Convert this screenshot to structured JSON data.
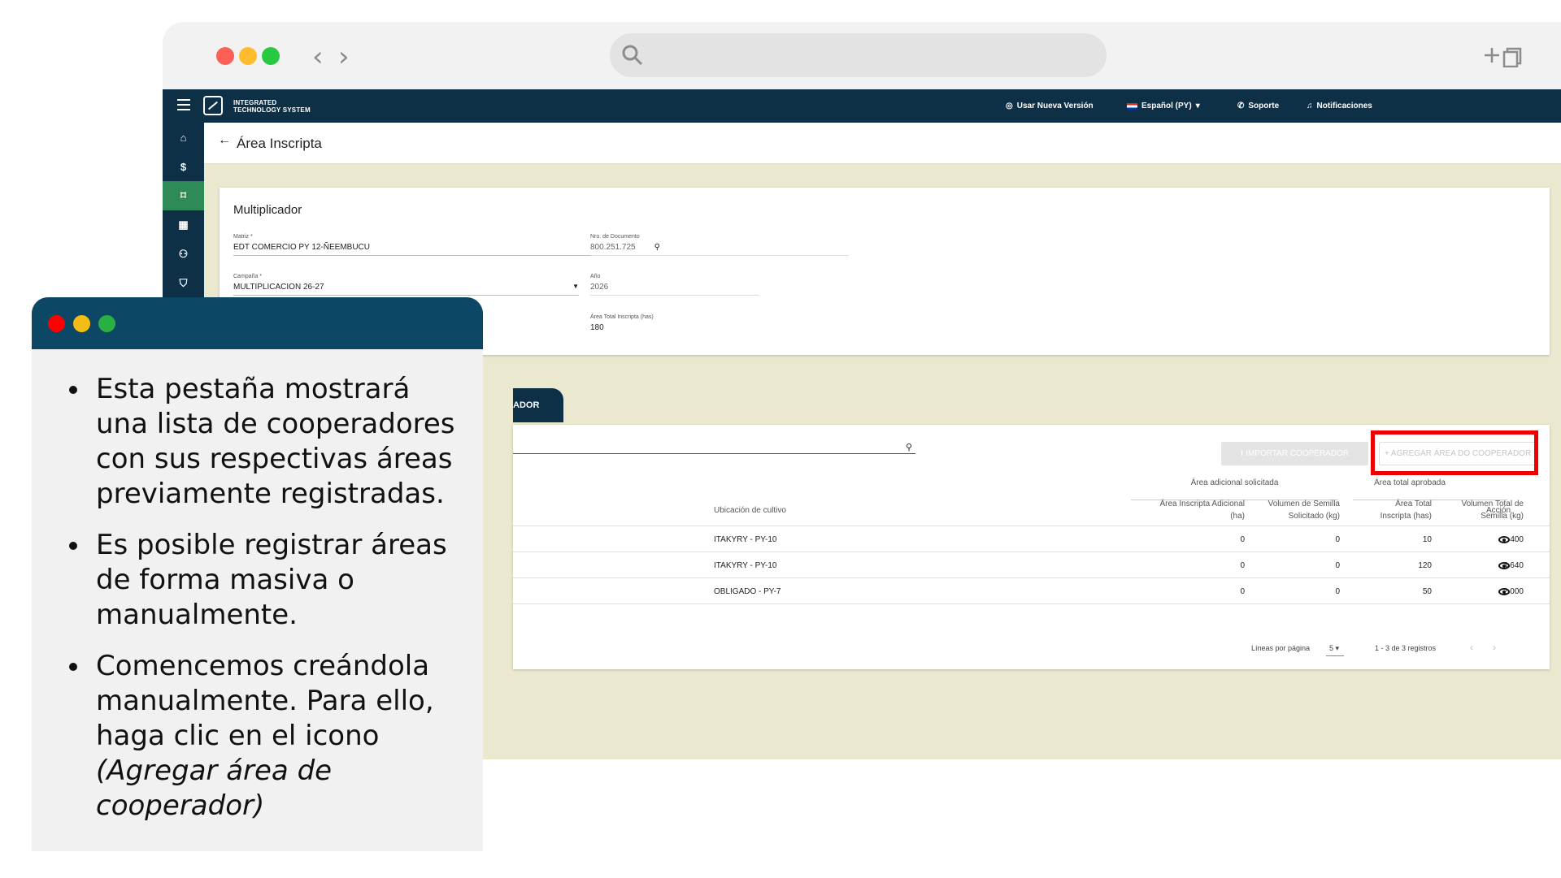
{
  "app": {
    "logo_line1": "INTEGRATED",
    "logo_line2": "TECHNOLOGY SYSTEM",
    "topbar": {
      "new_version": "Usar Nueva Versión",
      "language": "Español (PY)",
      "support": "Soporte",
      "notifications": "Notificaciones"
    },
    "page_title": "Área Inscripta",
    "sidebar_icons": [
      "home-icon",
      "dollar-icon",
      "area-icon",
      "report-icon",
      "users-icon",
      "shield-icon"
    ]
  },
  "multiplicador": {
    "title": "Multiplicador",
    "matriz_label": "Matriz *",
    "matriz_value": "EDT COMERCIO PY 12-ÑEEMBUCU",
    "doc_label": "Nro. de Documento",
    "doc_value": "800.251.725",
    "campana_label": "Campaña *",
    "campana_value": "MULTIPLICACION 26-27",
    "anio_label": "Año",
    "anio_value": "2026",
    "area_label": "Área Total Inscripta (has)",
    "area_value": "180"
  },
  "tab_label": "ADOR",
  "toolbar": {
    "import_label": "IMPORTAR COOPERADOR",
    "add_label": "AGREGAR ÁREA DO COOPERADOR"
  },
  "table": {
    "group_additional": "Área adicional solicitada",
    "group_approved": "Área total aprobada",
    "headers": {
      "ubicacion": "Ubicación de cultivo",
      "area_adicional": [
        "Área Inscripta Adicional",
        "(ha)"
      ],
      "vol_solicitado": [
        "Volumen de Semilla",
        "Solicitado (kg)"
      ],
      "area_total": [
        "Área Total",
        "Inscripta (has)"
      ],
      "vol_total": [
        "Volumen Total de",
        "Semilla (kg)"
      ],
      "accion": "Acción"
    },
    "rows": [
      {
        "ubicacion": "ITAKYRY - PY-10",
        "area_adicional": "0",
        "vol_solicitado": "0",
        "area_total": "10",
        "vol_total": "400"
      },
      {
        "ubicacion": "ITAKYRY - PY-10",
        "area_adicional": "0",
        "vol_solicitado": "0",
        "area_total": "120",
        "vol_total": "4.640"
      },
      {
        "ubicacion": "OBLIGADO - PY-7",
        "area_adicional": "0",
        "vol_solicitado": "0",
        "area_total": "50",
        "vol_total": "2.000"
      }
    ],
    "footer": {
      "rows_per_page_label": "Líneas por página",
      "rows_per_page_value": "5",
      "range": "1 - 3 de 3 registros"
    }
  },
  "overlay": {
    "bullet1": "Esta pestaña mostrará una lista de cooperadores con sus respectivas áreas previamente registradas.",
    "bullet2": "Es posible registrar áreas de forma masiva o manualmente.",
    "bullet3_plain": "Comencemos creándola manualmente. Para ello, haga clic en el icono",
    "bullet3_italic": "(Agregar área de cooperador)"
  },
  "colors": {
    "navy": "#0d3047",
    "overlay_header": "#0d4766",
    "content_bg": "#ebe8d0",
    "active_green": "#2e8b57",
    "highlight_red": "#ee0000"
  }
}
